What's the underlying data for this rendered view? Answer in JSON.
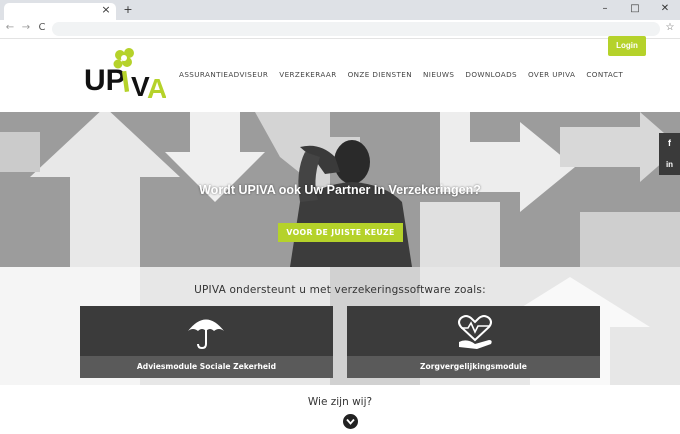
{
  "browser": {
    "tab_close": "×",
    "new_tab": "+",
    "window_controls": [
      "–",
      "□",
      "✕"
    ],
    "nav_icons": [
      "←",
      "→",
      "C"
    ],
    "star": "☆"
  },
  "header": {
    "login_label": "Login",
    "logo_text": "UPIVA",
    "nav": [
      "ASSURANTIEADVISEUR",
      "VERZEKERAAR",
      "ONZE DIENSTEN",
      "NIEUWS",
      "DOWNLOADS",
      "OVER UPIVA",
      "CONTACT"
    ]
  },
  "hero": {
    "headline": "Wordt UPIVA ook Uw Partner In Verzekeringen?",
    "button_label": "VOOR DE JUISTE KEUZE"
  },
  "social": [
    "f",
    "in"
  ],
  "services": {
    "intro": "UPIVA ondersteunt u met verzekeringssoftware zoals:",
    "cards": [
      {
        "title": "Adviesmodule Sociale Zekerheid",
        "icon": "umbrella-icon"
      },
      {
        "title": "Zorgvergelijkingsmodule",
        "icon": "heart-hand-icon"
      }
    ]
  },
  "about": {
    "heading": "Wie zijn wij?",
    "icon": "chevron-down-icon"
  },
  "colors": {
    "accent": "#b5d22a",
    "dark": "#3b3b3b"
  }
}
